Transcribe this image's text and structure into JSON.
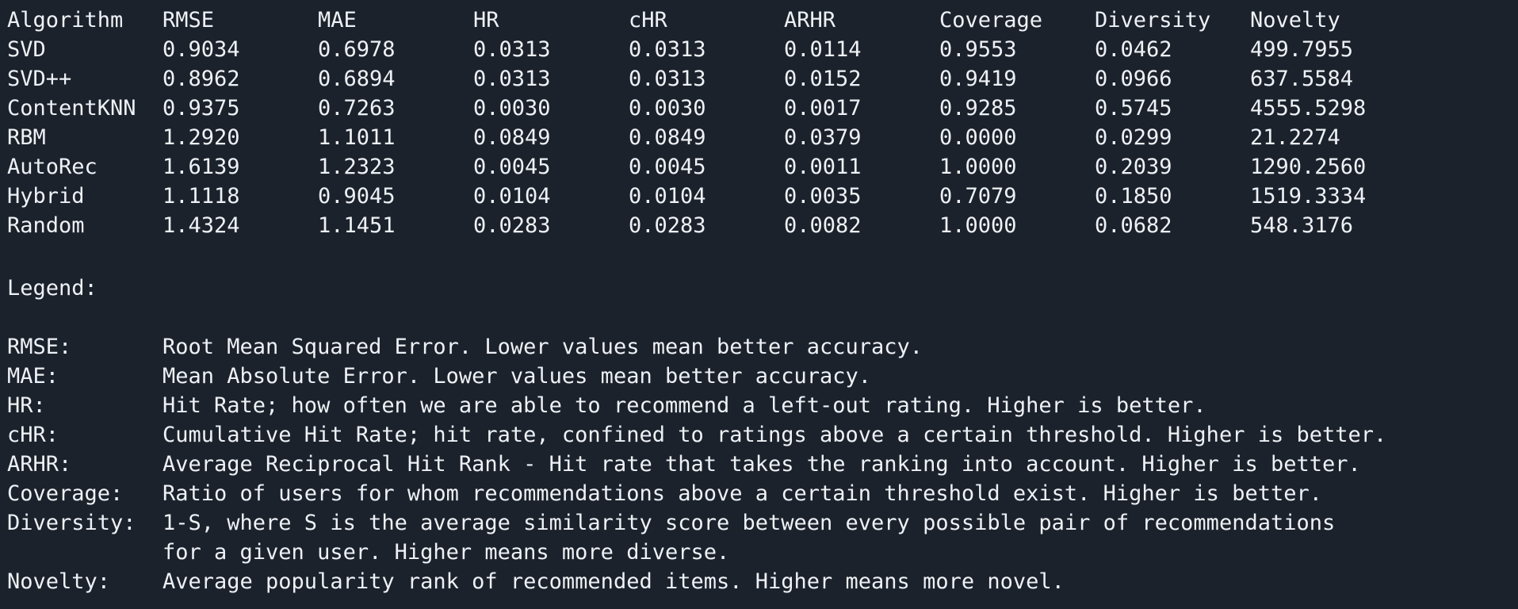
{
  "table": {
    "headers": [
      "Algorithm",
      "RMSE",
      "MAE",
      "HR",
      "cHR",
      "ARHR",
      "Coverage",
      "Diversity",
      "Novelty"
    ],
    "rows": [
      [
        "SVD",
        "0.9034",
        "0.6978",
        "0.0313",
        "0.0313",
        "0.0114",
        "0.9553",
        "0.0462",
        "499.7955"
      ],
      [
        "SVD++",
        "0.8962",
        "0.6894",
        "0.0313",
        "0.0313",
        "0.0152",
        "0.9419",
        "0.0966",
        "637.5584"
      ],
      [
        "ContentKNN",
        "0.9375",
        "0.7263",
        "0.0030",
        "0.0030",
        "0.0017",
        "0.9285",
        "0.5745",
        "4555.5298"
      ],
      [
        "RBM",
        "1.2920",
        "1.1011",
        "0.0849",
        "0.0849",
        "0.0379",
        "0.0000",
        "0.0299",
        "21.2274"
      ],
      [
        "AutoRec",
        "1.6139",
        "1.2323",
        "0.0045",
        "0.0045",
        "0.0011",
        "1.0000",
        "0.2039",
        "1290.2560"
      ],
      [
        "Hybrid",
        "1.1118",
        "0.9045",
        "0.0104",
        "0.0104",
        "0.0035",
        "0.7079",
        "0.1850",
        "1519.3334"
      ],
      [
        "Random",
        "1.4324",
        "1.1451",
        "0.0283",
        "0.0283",
        "0.0082",
        "1.0000",
        "0.0682",
        "548.3176"
      ]
    ]
  },
  "legend": {
    "title": "Legend:",
    "items": [
      {
        "term": "RMSE:",
        "desc": "Root Mean Squared Error. Lower values mean better accuracy."
      },
      {
        "term": "MAE:",
        "desc": "Mean Absolute Error. Lower values mean better accuracy."
      },
      {
        "term": "HR:",
        "desc": "Hit Rate; how often we are able to recommend a left-out rating. Higher is better."
      },
      {
        "term": "cHR:",
        "desc": "Cumulative Hit Rate; hit rate, confined to ratings above a certain threshold. Higher is better."
      },
      {
        "term": "ARHR:",
        "desc": "Average Reciprocal Hit Rank - Hit rate that takes the ranking into account. Higher is better."
      },
      {
        "term": "Coverage:",
        "desc": "Ratio of users for whom recommendations above a certain threshold exist. Higher is better."
      },
      {
        "term": "Diversity:",
        "desc": "1-S, where S is the average similarity score between every possible pair of recommendations"
      },
      {
        "term": "",
        "desc": "for a given user. Higher means more diverse."
      },
      {
        "term": "Novelty:",
        "desc": "Average popularity rank of recommended items. Higher means more novel."
      }
    ]
  },
  "colors": {
    "background": "#1c222c",
    "text": "#eef1f5"
  }
}
